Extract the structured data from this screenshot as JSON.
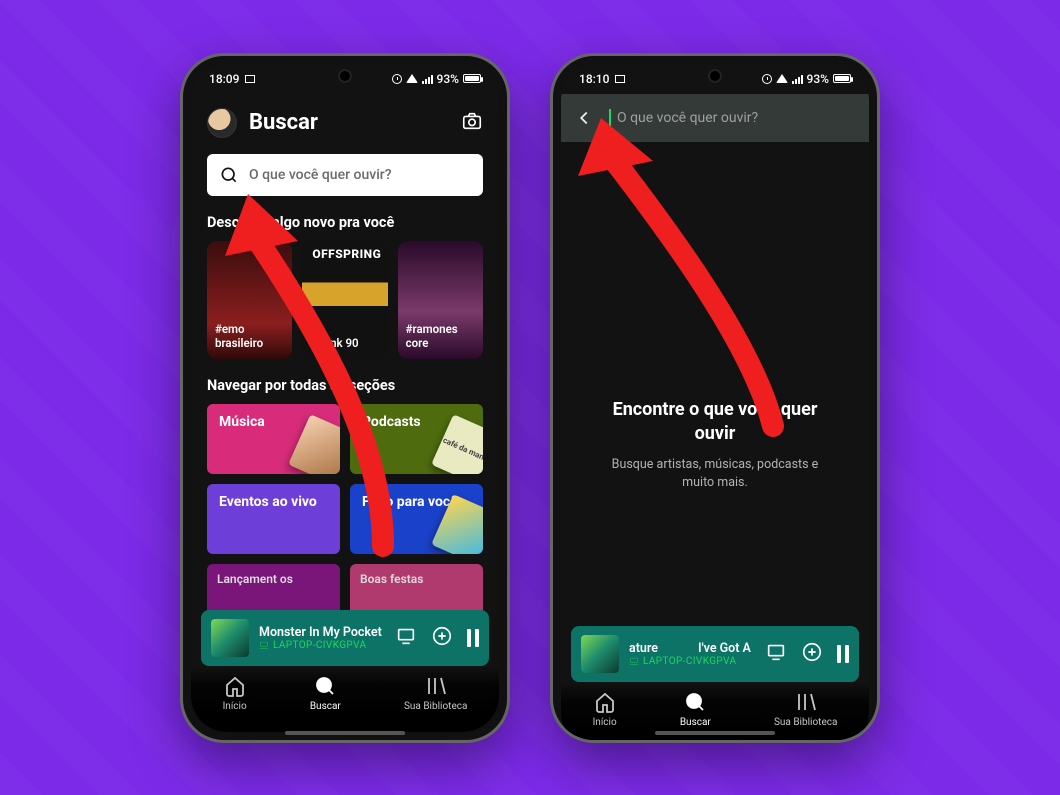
{
  "status_bar": {
    "time_left": "18:09",
    "time_right": "18:10",
    "battery_pct": "93%"
  },
  "phone1": {
    "title": "Buscar",
    "search_placeholder": "O que você quer ouvir?",
    "discover_heading": "Descubra algo novo pra você",
    "discover": [
      {
        "tag": "#emo brasileiro"
      },
      {
        "tag": "#punk 90",
        "overlay": "OFFSPRING"
      },
      {
        "tag": "#ramones core"
      }
    ],
    "browse_heading": "Navegar por todas as seções",
    "categories": [
      {
        "label": "Música"
      },
      {
        "label": "Podcasts",
        "thumb_text": "café da manhã"
      },
      {
        "label": "Eventos ao vivo"
      },
      {
        "label": "Feito para você"
      }
    ],
    "peek": [
      {
        "label": "Lançament os"
      },
      {
        "label": "Boas festas"
      }
    ],
    "now_playing": {
      "track": "Monster In My Pocket",
      "device": "LAPTOP-CIVKGPVA"
    }
  },
  "phone2": {
    "search_placeholder": "O que você quer ouvir?",
    "empty_title": "Encontre o que você quer ouvir",
    "empty_subtitle": "Busque artistas, músicas, podcasts e muito mais.",
    "now_playing": {
      "track_left": "ature",
      "track_right": "I've Got A",
      "device": "LAPTOP-CIVKGPVA"
    }
  },
  "bottom_nav": {
    "home": "Início",
    "search": "Buscar",
    "library": "Sua Biblioteca"
  }
}
